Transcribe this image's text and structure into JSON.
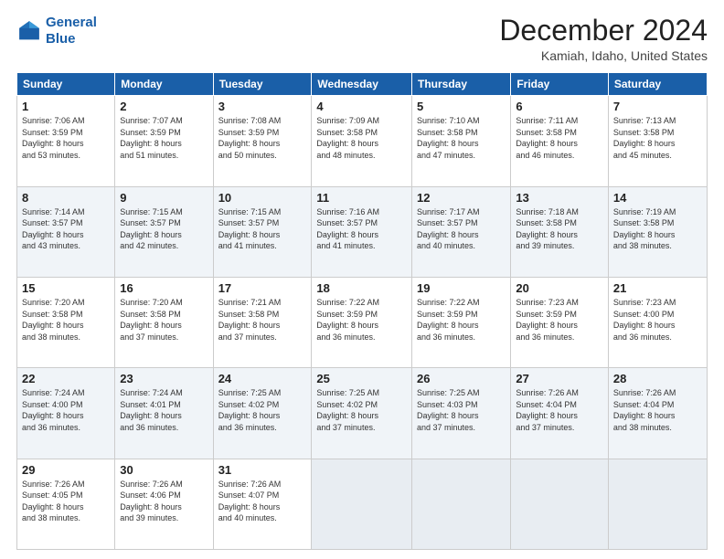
{
  "header": {
    "logo_line1": "General",
    "logo_line2": "Blue",
    "title": "December 2024",
    "subtitle": "Kamiah, Idaho, United States"
  },
  "weekdays": [
    "Sunday",
    "Monday",
    "Tuesday",
    "Wednesday",
    "Thursday",
    "Friday",
    "Saturday"
  ],
  "weeks": [
    [
      {
        "day": "1",
        "info": "Sunrise: 7:06 AM\nSunset: 3:59 PM\nDaylight: 8 hours\nand 53 minutes."
      },
      {
        "day": "2",
        "info": "Sunrise: 7:07 AM\nSunset: 3:59 PM\nDaylight: 8 hours\nand 51 minutes."
      },
      {
        "day": "3",
        "info": "Sunrise: 7:08 AM\nSunset: 3:59 PM\nDaylight: 8 hours\nand 50 minutes."
      },
      {
        "day": "4",
        "info": "Sunrise: 7:09 AM\nSunset: 3:58 PM\nDaylight: 8 hours\nand 48 minutes."
      },
      {
        "day": "5",
        "info": "Sunrise: 7:10 AM\nSunset: 3:58 PM\nDaylight: 8 hours\nand 47 minutes."
      },
      {
        "day": "6",
        "info": "Sunrise: 7:11 AM\nSunset: 3:58 PM\nDaylight: 8 hours\nand 46 minutes."
      },
      {
        "day": "7",
        "info": "Sunrise: 7:13 AM\nSunset: 3:58 PM\nDaylight: 8 hours\nand 45 minutes."
      }
    ],
    [
      {
        "day": "8",
        "info": "Sunrise: 7:14 AM\nSunset: 3:57 PM\nDaylight: 8 hours\nand 43 minutes."
      },
      {
        "day": "9",
        "info": "Sunrise: 7:15 AM\nSunset: 3:57 PM\nDaylight: 8 hours\nand 42 minutes."
      },
      {
        "day": "10",
        "info": "Sunrise: 7:15 AM\nSunset: 3:57 PM\nDaylight: 8 hours\nand 41 minutes."
      },
      {
        "day": "11",
        "info": "Sunrise: 7:16 AM\nSunset: 3:57 PM\nDaylight: 8 hours\nand 41 minutes."
      },
      {
        "day": "12",
        "info": "Sunrise: 7:17 AM\nSunset: 3:57 PM\nDaylight: 8 hours\nand 40 minutes."
      },
      {
        "day": "13",
        "info": "Sunrise: 7:18 AM\nSunset: 3:58 PM\nDaylight: 8 hours\nand 39 minutes."
      },
      {
        "day": "14",
        "info": "Sunrise: 7:19 AM\nSunset: 3:58 PM\nDaylight: 8 hours\nand 38 minutes."
      }
    ],
    [
      {
        "day": "15",
        "info": "Sunrise: 7:20 AM\nSunset: 3:58 PM\nDaylight: 8 hours\nand 38 minutes."
      },
      {
        "day": "16",
        "info": "Sunrise: 7:20 AM\nSunset: 3:58 PM\nDaylight: 8 hours\nand 37 minutes."
      },
      {
        "day": "17",
        "info": "Sunrise: 7:21 AM\nSunset: 3:58 PM\nDaylight: 8 hours\nand 37 minutes."
      },
      {
        "day": "18",
        "info": "Sunrise: 7:22 AM\nSunset: 3:59 PM\nDaylight: 8 hours\nand 36 minutes."
      },
      {
        "day": "19",
        "info": "Sunrise: 7:22 AM\nSunset: 3:59 PM\nDaylight: 8 hours\nand 36 minutes."
      },
      {
        "day": "20",
        "info": "Sunrise: 7:23 AM\nSunset: 3:59 PM\nDaylight: 8 hours\nand 36 minutes."
      },
      {
        "day": "21",
        "info": "Sunrise: 7:23 AM\nSunset: 4:00 PM\nDaylight: 8 hours\nand 36 minutes."
      }
    ],
    [
      {
        "day": "22",
        "info": "Sunrise: 7:24 AM\nSunset: 4:00 PM\nDaylight: 8 hours\nand 36 minutes."
      },
      {
        "day": "23",
        "info": "Sunrise: 7:24 AM\nSunset: 4:01 PM\nDaylight: 8 hours\nand 36 minutes."
      },
      {
        "day": "24",
        "info": "Sunrise: 7:25 AM\nSunset: 4:02 PM\nDaylight: 8 hours\nand 36 minutes."
      },
      {
        "day": "25",
        "info": "Sunrise: 7:25 AM\nSunset: 4:02 PM\nDaylight: 8 hours\nand 37 minutes."
      },
      {
        "day": "26",
        "info": "Sunrise: 7:25 AM\nSunset: 4:03 PM\nDaylight: 8 hours\nand 37 minutes."
      },
      {
        "day": "27",
        "info": "Sunrise: 7:26 AM\nSunset: 4:04 PM\nDaylight: 8 hours\nand 37 minutes."
      },
      {
        "day": "28",
        "info": "Sunrise: 7:26 AM\nSunset: 4:04 PM\nDaylight: 8 hours\nand 38 minutes."
      }
    ],
    [
      {
        "day": "29",
        "info": "Sunrise: 7:26 AM\nSunset: 4:05 PM\nDaylight: 8 hours\nand 38 minutes."
      },
      {
        "day": "30",
        "info": "Sunrise: 7:26 AM\nSunset: 4:06 PM\nDaylight: 8 hours\nand 39 minutes."
      },
      {
        "day": "31",
        "info": "Sunrise: 7:26 AM\nSunset: 4:07 PM\nDaylight: 8 hours\nand 40 minutes."
      },
      null,
      null,
      null,
      null
    ]
  ]
}
